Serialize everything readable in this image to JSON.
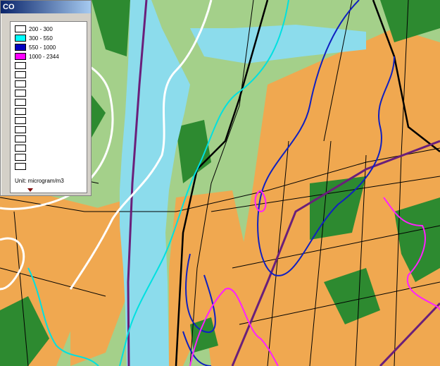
{
  "legend": {
    "title": "CO",
    "ranges": [
      {
        "label": "200 - 300",
        "color": "#ffffff"
      },
      {
        "label": "300 - 550",
        "color": "#00ffff"
      },
      {
        "label": "550 - 1000",
        "color": "#0000c0"
      },
      {
        "label": "1000 - 2344",
        "color": "#ff00ff"
      }
    ],
    "empty_slots": 12,
    "unit": "Unit: microgram/m3"
  },
  "map_colors": {
    "river": "#8cdcec",
    "grass": "#a4d08a",
    "forest": "#2d8a30",
    "urban": "#f0a850",
    "road": "#000000",
    "border": "#6a1f7a"
  }
}
